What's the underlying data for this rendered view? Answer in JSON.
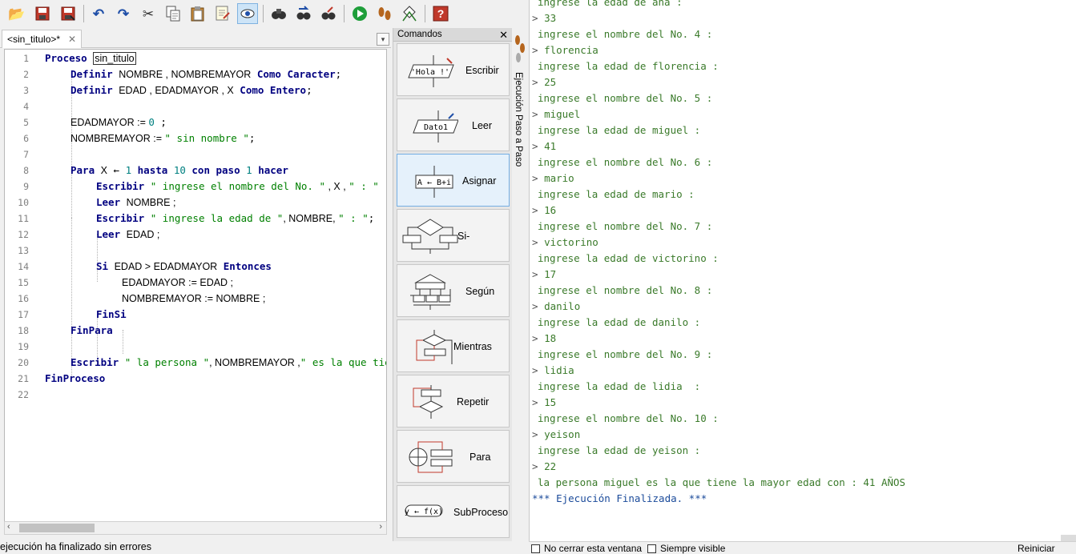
{
  "toolbar": {
    "icons": [
      "open-icon",
      "save-icon",
      "save-as-icon",
      "undo-icon",
      "redo-icon",
      "cut-icon",
      "copy-icon",
      "paste-icon",
      "edit-icon",
      "view-icon",
      "find-icon",
      "find-next-icon",
      "replace-icon",
      "run-icon",
      "step-icon",
      "flowchart-icon",
      "help-icon"
    ]
  },
  "tab": {
    "label": "<sin_titulo>*",
    "close": "✕"
  },
  "editor": {
    "line_numbers": [
      "1",
      "2",
      "3",
      "4",
      "5",
      "6",
      "7",
      "8",
      "9",
      "10",
      "11",
      "12",
      "13",
      "14",
      "15",
      "16",
      "17",
      "18",
      "19",
      "20",
      "21",
      "22"
    ],
    "l1": {
      "kw": "Proceso",
      "name": "sin_titulo"
    },
    "l2": {
      "kw": "Definir",
      "vars": "NOMBRE , NOMBREMAYOR",
      "kw2": "Como Caracter",
      "end": ";"
    },
    "l3": {
      "kw": "Definir",
      "vars": "EDAD , EDADMAYOR , X",
      "kw2": "Como Entero",
      "end": ";"
    },
    "l5": {
      "var": "EDADMAYOR := ",
      "num": "0",
      "end": " ;"
    },
    "l6": {
      "var": "NOMBREMAYOR := ",
      "str": "\" sin nombre \"",
      "end": ";"
    },
    "l8": {
      "kw": "Para",
      "var": "X",
      "arrow": "←",
      "n1": "1",
      "kw2": "hasta",
      "n2": "10",
      "kw3": "con paso",
      "n3": "1",
      "kw4": "hacer"
    },
    "l9": {
      "kw": "Escribir",
      "str1": "\" ingrese el nombre del No. \"",
      "mid": " , X , ",
      "str2": "\" : \""
    },
    "l10": {
      "kw": "Leer",
      "rest": "NOMBRE ;"
    },
    "l11": {
      "kw": "Escribir",
      "str1": "\" ingrese la edad de \"",
      "mid": ", NOMBRE, ",
      "str2": "\" : \"",
      "end": ";"
    },
    "l12": {
      "kw": "Leer",
      "rest": "EDAD ;"
    },
    "l14": {
      "kw": "Si",
      "rest": "EDAD > EDADMAYOR",
      "kw2": "Entonces"
    },
    "l15": {
      "rest": "EDADMAYOR := EDAD ;"
    },
    "l16": {
      "rest": "NOMBREMAYOR := NOMBRE ;"
    },
    "l17": {
      "kw": "FinSi"
    },
    "l18": {
      "kw": "FinPara"
    },
    "l20": {
      "kw": "Escribir",
      "str1": "\" la persona \"",
      "mid": ", NOMBREMAYOR ,",
      "str2": "\" es la que tiene"
    },
    "l21": {
      "kw": "FinProceso"
    }
  },
  "status": {
    "text": "ejecución ha finalizado sin errores"
  },
  "commands": {
    "title": "Comandos",
    "close": "✕",
    "items": [
      {
        "label": "Escribir",
        "icon_text": "'Hola !'"
      },
      {
        "label": "Leer",
        "icon_text": "Dato1"
      },
      {
        "label": "Asignar",
        "icon_text": "A ← B+i"
      },
      {
        "label": "Si-Entonces"
      },
      {
        "label": "Según"
      },
      {
        "label": "Mientras"
      },
      {
        "label": "Repetir"
      },
      {
        "label": "Para"
      },
      {
        "label": "SubProceso",
        "icon_text": "y ← f(x)"
      }
    ]
  },
  "step_panel": {
    "label": "Ejecución Paso a Paso"
  },
  "console": {
    "lines": [
      {
        "type": "out",
        "text": "ingrese la edad de ana :"
      },
      {
        "type": "in",
        "text": "33"
      },
      {
        "type": "out",
        "text": "ingrese el nombre del No. 4 :"
      },
      {
        "type": "in",
        "text": "florencia"
      },
      {
        "type": "out",
        "text": "ingrese la edad de florencia :"
      },
      {
        "type": "in",
        "text": "25"
      },
      {
        "type": "out",
        "text": "ingrese el nombre del No. 5 :"
      },
      {
        "type": "in",
        "text": "miguel"
      },
      {
        "type": "out",
        "text": "ingrese la edad de miguel :"
      },
      {
        "type": "in",
        "text": "41"
      },
      {
        "type": "out",
        "text": "ingrese el nombre del No. 6 :"
      },
      {
        "type": "in",
        "text": "mario"
      },
      {
        "type": "out",
        "text": "ingrese la edad de mario :"
      },
      {
        "type": "in",
        "text": "16"
      },
      {
        "type": "out",
        "text": "ingrese el nombre del No. 7 :"
      },
      {
        "type": "in",
        "text": "victorino"
      },
      {
        "type": "out",
        "text": "ingrese la edad de victorino :"
      },
      {
        "type": "in",
        "text": "17"
      },
      {
        "type": "out",
        "text": "ingrese el nombre del No. 8 :"
      },
      {
        "type": "in",
        "text": "danilo"
      },
      {
        "type": "out",
        "text": "ingrese la edad de danilo :"
      },
      {
        "type": "in",
        "text": "18"
      },
      {
        "type": "out",
        "text": "ingrese el nombre del No. 9 :"
      },
      {
        "type": "in",
        "text": "lidia"
      },
      {
        "type": "out",
        "text": "ingrese la edad de lidia  :"
      },
      {
        "type": "in",
        "text": "15"
      },
      {
        "type": "out",
        "text": "ingrese el nombre del No. 10 :"
      },
      {
        "type": "in",
        "text": "yeison"
      },
      {
        "type": "out",
        "text": "ingrese la edad de yeison :"
      },
      {
        "type": "in",
        "text": "22"
      },
      {
        "type": "out",
        "text": "la persona miguel es la que tiene la mayor edad con : 41 AÑOS"
      },
      {
        "type": "fin",
        "text": "*** Ejecución Finalizada. ***"
      }
    ],
    "prompt": "> ",
    "no_cerrar": "No cerrar esta ventana",
    "siempre_visible": "Siempre visible",
    "reiniciar": "Reiniciar"
  }
}
